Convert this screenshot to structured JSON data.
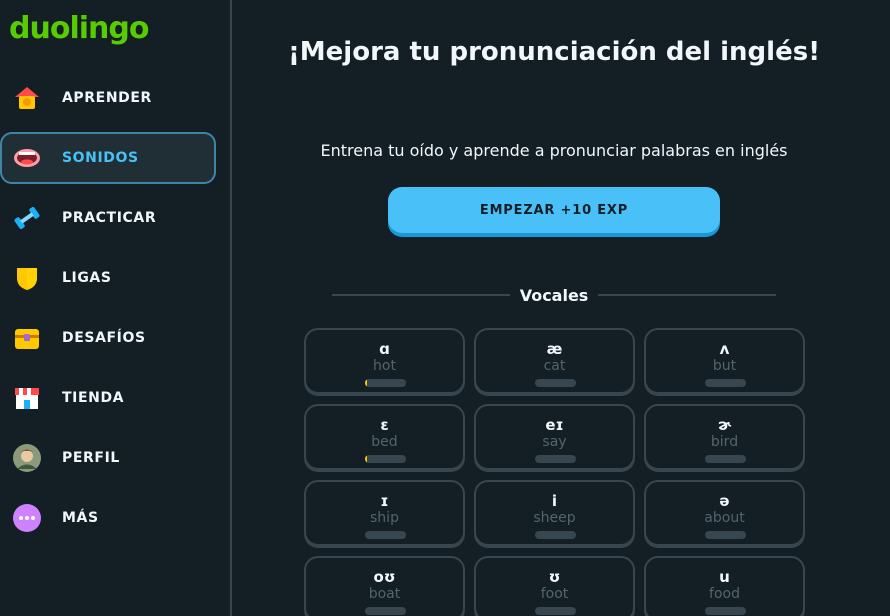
{
  "app": {
    "logo_text": "duolingo",
    "brand_color": "#58cc02",
    "accent_color": "#49c0f8"
  },
  "sidebar": {
    "items": [
      {
        "label": "APRENDER",
        "icon": "home-icon",
        "active": false
      },
      {
        "label": "SONIDOS",
        "icon": "mouth-icon",
        "active": true
      },
      {
        "label": "PRACTICAR",
        "icon": "dumbbell-icon",
        "active": false
      },
      {
        "label": "LIGAS",
        "icon": "shield-icon",
        "active": false
      },
      {
        "label": "DESAFÍOS",
        "icon": "treasure-chest-icon",
        "active": false
      },
      {
        "label": "TIENDA",
        "icon": "shop-icon",
        "active": false
      },
      {
        "label": "PERFIL",
        "icon": "avatar-icon",
        "active": false
      },
      {
        "label": "MÁS",
        "icon": "more-icon",
        "active": false
      }
    ]
  },
  "main": {
    "title": "¡Mejora tu pronunciación del inglés!",
    "subtitle": "Entrena tu oído y aprende a pronunciar palabras en inglés",
    "start_button": "EMPEZAR +10 EXP",
    "section_title": "Vocales",
    "sounds": [
      {
        "symbol": "ɑ",
        "word": "hot",
        "progress": 0.05
      },
      {
        "symbol": "æ",
        "word": "cat",
        "progress": 0
      },
      {
        "symbol": "ʌ",
        "word": "but",
        "progress": 0
      },
      {
        "symbol": "ɛ",
        "word": "bed",
        "progress": 0.05
      },
      {
        "symbol": "eɪ",
        "word": "say",
        "progress": 0
      },
      {
        "symbol": "ɚ",
        "word": "bird",
        "progress": 0
      },
      {
        "symbol": "ɪ",
        "word": "ship",
        "progress": 0
      },
      {
        "symbol": "i",
        "word": "sheep",
        "progress": 0
      },
      {
        "symbol": "ə",
        "word": "about",
        "progress": 0
      },
      {
        "symbol": "oʊ",
        "word": "boat",
        "progress": 0
      },
      {
        "symbol": "ʊ",
        "word": "foot",
        "progress": 0
      },
      {
        "symbol": "u",
        "word": "food",
        "progress": 0
      }
    ]
  }
}
